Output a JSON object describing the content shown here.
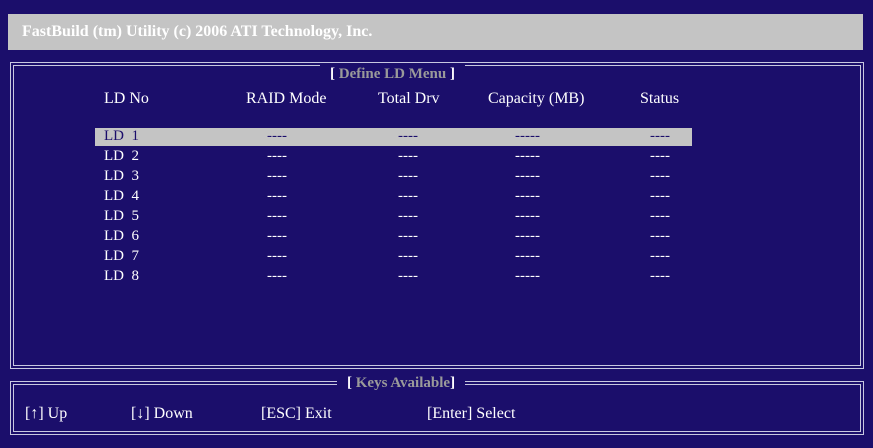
{
  "header": {
    "title": "FastBuild (tm) Utility (c) 2006 ATI Technology, Inc."
  },
  "menu": {
    "bracket_open": "[",
    "bracket_close": "]",
    "title": "Define LD Menu",
    "columns": [
      "LD No",
      "RAID Mode",
      "Total Drv",
      "Capacity (MB)",
      "Status"
    ],
    "selected_index": 0,
    "rows": [
      {
        "ld": "LD  1",
        "raid": "----",
        "drv": "----",
        "cap": "-----",
        "status": "----"
      },
      {
        "ld": "LD  2",
        "raid": "----",
        "drv": "----",
        "cap": "-----",
        "status": "----"
      },
      {
        "ld": "LD  3",
        "raid": "----",
        "drv": "----",
        "cap": "-----",
        "status": "----"
      },
      {
        "ld": "LD  4",
        "raid": "----",
        "drv": "----",
        "cap": "-----",
        "status": "----"
      },
      {
        "ld": "LD  5",
        "raid": "----",
        "drv": "----",
        "cap": "-----",
        "status": "----"
      },
      {
        "ld": "LD  6",
        "raid": "----",
        "drv": "----",
        "cap": "-----",
        "status": "----"
      },
      {
        "ld": "LD  7",
        "raid": "----",
        "drv": "----",
        "cap": "-----",
        "status": "----"
      },
      {
        "ld": "LD  8",
        "raid": "----",
        "drv": "----",
        "cap": "-----",
        "status": "----"
      }
    ]
  },
  "keys": {
    "title": "Keys Available",
    "bracket_open": "[",
    "bracket_close": "]",
    "up": "[↑] Up",
    "down": "[↓] Down",
    "esc": "[ESC] Exit",
    "enter": "[Enter] Select"
  },
  "colors": {
    "background": "#1b0e6b",
    "title_bar": "#c4c4c4",
    "highlight": "#c4c4c4",
    "muted_title": "#9a9a9a"
  }
}
